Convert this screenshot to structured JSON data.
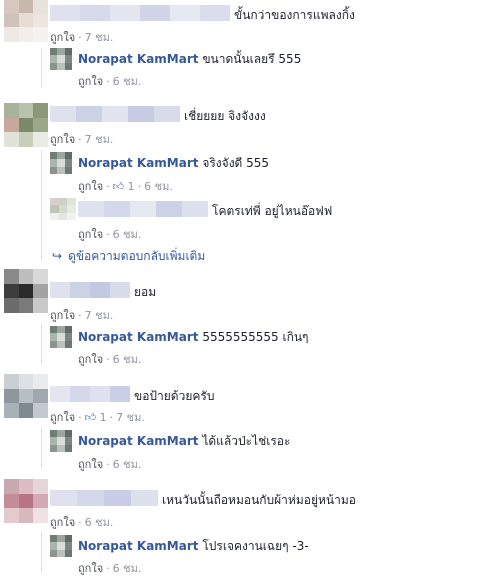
{
  "comments": [
    {
      "text": "ขั้นกว่าของการแพลงกิ้ง",
      "like": "ถูกใจ",
      "time": "7 ชม."
    },
    {
      "text": "ขนาดนั้นเลยรึ 555",
      "author": "Norapat KamMart",
      "like": "ถูกใจ",
      "time": "6 ชม."
    },
    {
      "text": "เชี่ยยยย จิงจังงง",
      "like": "ถูกใจ",
      "time": "7 ชม."
    },
    {
      "text": "จริงจังดี 555",
      "author": "Norapat KamMart",
      "like": "ถูกใจ",
      "likes": "1",
      "time": "6 ชม."
    },
    {
      "text": "โคตรเท่พี่ อยู่ไหนอ๊อฟฟ",
      "like": "ถูกใจ",
      "time": "6 ชม."
    },
    {
      "text": "ยอม",
      "like": "ถูกใจ",
      "time": "7 ชม."
    },
    {
      "text": "5555555555 เกินๆ",
      "author": "Norapat KamMart",
      "like": "ถูกใจ",
      "time": "6 ชม."
    },
    {
      "text": "ขอป้ายด้วยครับ",
      "like": "ถูกใจ",
      "likes": "1",
      "time": "7 ชม."
    },
    {
      "text": "ได้แล้วป่ะไช่เรอะ",
      "author": "Norapat KamMart",
      "like": "ถูกใจ",
      "time": "6 ชม."
    },
    {
      "text": "เหนวันนั้นถือหมอนกับผ้าห่มอยู่หน้ามอ",
      "like": "ถูกใจ",
      "time": "6 ชม."
    },
    {
      "text": "โปรเจคงานเฉยๆ -3-",
      "author": "Norapat KamMart",
      "like": "ถูกใจ",
      "time": "6 ชม."
    }
  ],
  "more_replies": "ดูข้อความตอบกลับเพิ่มเติม",
  "colors": {
    "author": "#365899",
    "meta": "#90949c",
    "like_blue": "#4267b2"
  },
  "icons": {
    "like": "thumbs-up-icon",
    "reply_arrow": "reply-arrow-icon"
  }
}
